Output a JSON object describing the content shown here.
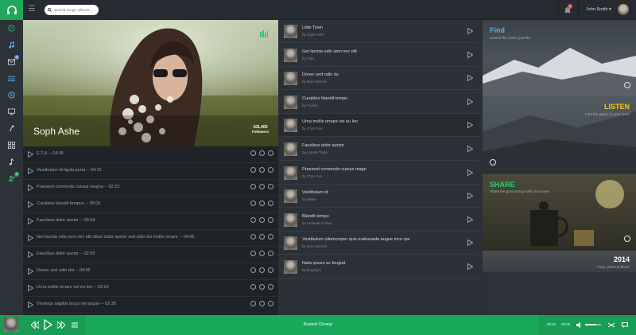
{
  "search": {
    "placeholder": "Search songs, albums..."
  },
  "header": {
    "notifications_count": "3",
    "user_name": "John.Smith"
  },
  "sidebar": {
    "items": [
      {
        "icon": "compass-icon"
      },
      {
        "icon": "music-note-icon"
      },
      {
        "icon": "mail-icon",
        "badge": "6"
      },
      {
        "icon": "list-icon"
      },
      {
        "icon": "disc-icon"
      },
      {
        "icon": "monitor-icon"
      },
      {
        "icon": "microphone-icon"
      },
      {
        "icon": "grid-icon"
      },
      {
        "icon": "music-icon"
      },
      {
        "icon": "people-icon",
        "badge": "9"
      }
    ]
  },
  "hero": {
    "artist": "Soph Ashe",
    "followers_count": "101,400",
    "followers_label": "Followers"
  },
  "tracks": [
    {
      "title": "E.T.H",
      "duration": "04:35"
    },
    {
      "title": "Vestibulum id ligula porta",
      "duration": "04:15"
    },
    {
      "title": "Praesent commodo cursus magna",
      "duration": "02:23"
    },
    {
      "title": "Curabitur blandit tempus",
      "duration": "05:00"
    },
    {
      "title": "Faucibus dolor auctor",
      "duration": "03:59"
    },
    {
      "title": "Get lacinia odio sem nec elit cibus dolor auctor sed odio dui mollis ornare",
      "duration": "04:05"
    },
    {
      "title": "Faucibus dolor auctor",
      "duration": "02:55"
    },
    {
      "title": "Donec sed odio dui",
      "duration": "04:35"
    },
    {
      "title": "Urna mollis ornare vel eu leo",
      "duration": "03:10"
    },
    {
      "title": "Vivamus sagittis lacus vel augue",
      "duration": "02:35"
    }
  ],
  "playlist": [
    {
      "title": "Little Town",
      "artist": "by Soph Ashe"
    },
    {
      "title": "Get lacinia odio sem nec elit",
      "artist": "by Filex"
    },
    {
      "title": "Donec sed odio du",
      "artist": "by Dan Dorrack"
    },
    {
      "title": "Curabitur blandit tempu",
      "artist": "by Fuales"
    },
    {
      "title": "Urna mollis ornare vel eu leo",
      "artist": "by Chris Fox"
    },
    {
      "title": "Faucibus dolor auctor",
      "artist": "by Lauren Taylor"
    },
    {
      "title": "Praesent commodo cursus magn",
      "artist": "by Chris Fox"
    },
    {
      "title": "Vestibulum id",
      "artist": "by Milian"
    },
    {
      "title": "Blandit tempu",
      "artist": "by Amanda Conlan"
    },
    {
      "title": "Vestibulum ullamcorper quis malesuada augue mco rpe",
      "artist": "by Dan Dorrack"
    },
    {
      "title": "Natis ipsum ac feugiat",
      "artist": "by Dandium"
    }
  ],
  "panels": {
    "find": {
      "title": "Find",
      "subtitle": "Search the music you like"
    },
    "listen": {
      "title": "LISTEN",
      "subtitle": "Find the peace in your heart"
    },
    "share": {
      "title": "SHARE",
      "subtitle": "Share the good songs with your loves"
    },
    "year": {
      "title": "2014",
      "subtitle": "Find, Listen & Share"
    }
  },
  "player": {
    "song_title": "Busted Chump",
    "elapsed": "00:00",
    "total": "00:00",
    "volume": 0.7
  },
  "colors": {
    "accent": "#1aa85a",
    "listen": "#f5c518",
    "share": "#2ecc71",
    "find": "#5fb4e5"
  }
}
